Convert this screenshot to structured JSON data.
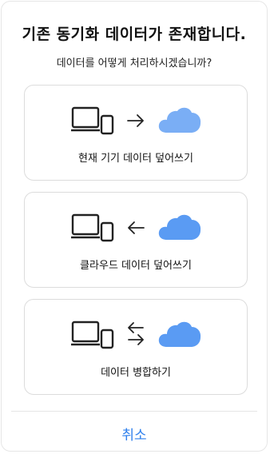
{
  "dialog": {
    "title": "기존 동기화 데이터가 존재합니다.",
    "subtitle": "데이터를 어떻게 처리하시겠습니까?",
    "options": [
      {
        "label": "현재 기기 데이터 덮어쓰기",
        "direction_icon": "arrow-right-icon"
      },
      {
        "label": "클라우드 데이터 덮어쓰기",
        "direction_icon": "arrow-left-icon"
      },
      {
        "label": "데이터 병합하기",
        "direction_icon": "swap-arrows-icon"
      }
    ],
    "cancel_label": "취소"
  },
  "colors": {
    "cloud": "#7aaef5",
    "cloud_accent": "#5a9bf3",
    "device_stroke": "#222222",
    "cancel": "#2f80ed"
  }
}
